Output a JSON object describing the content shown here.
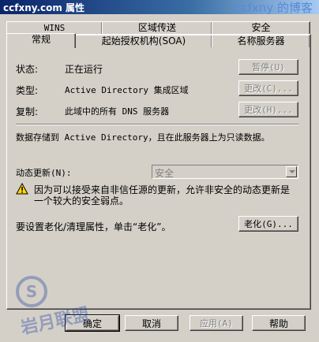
{
  "window": {
    "title": "ccfxny.com 属性",
    "watermark": "ccfxny 的博客"
  },
  "tabs_back": [
    "WINS",
    "区域传送",
    "安全"
  ],
  "tabs_front": [
    "常规",
    "起始授权机构(SOA)",
    "名称服务器"
  ],
  "general": {
    "status_label": "状态:",
    "status_value": "正在运行",
    "pause_button": "暂停(U)",
    "type_label": "类型:",
    "type_value": "Active Directory 集成区域",
    "type_change_button": "更改(C)...",
    "replication_label": "复制:",
    "replication_value": "此域中的所有 DNS 服务器",
    "replication_change_button": "更改(H)...",
    "storage_note": "数据存储到 Active Directory，且在此服务器上为只读数据。",
    "dynamic_update_label": "动态更新(N):",
    "dynamic_update_value": "安全",
    "warning_line1": "因为可以接受来自非信任源的更新，允许非安全的动态更新是",
    "warning_line2": "一个较大的安全弱点。",
    "aging_note": "要设置老化/清理属性，单击“老化”。",
    "aging_button": "老化(G)..."
  },
  "footer": {
    "ok": "确定",
    "cancel": "取消",
    "apply": "应用(A)",
    "help": "帮助"
  },
  "stamp_text": "岩月联盟",
  "icons": {
    "warning": "warning-icon"
  }
}
